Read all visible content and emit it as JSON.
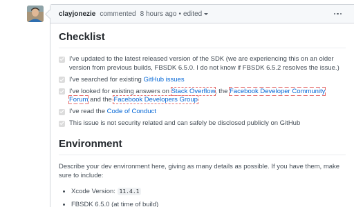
{
  "comment": {
    "author": "clayjonezie",
    "action": "commented",
    "time": "8 hours ago",
    "separator": "•",
    "edited_label": "edited",
    "more_label": "..."
  },
  "checklist": {
    "heading": "Checklist",
    "items": [
      {
        "text_before": "I've updated to the latest released version of the SDK (we are experiencing this on an older version from previous builds, FBSDK 6.5.0. I do not know if FBSDK 6.5.2 resolves the issue.)",
        "checked": true
      },
      {
        "text_before": "I've searched for existing ",
        "link": "GitHub issues",
        "checked": true
      },
      {
        "text_before": "I've looked for existing answers on ",
        "link1": "Stack Overflow",
        "text_mid1": ", the ",
        "link2": "Facebook Developer Community Forum",
        "text_mid2": " and the ",
        "link3": "Facebook Developers Group",
        "checked": true
      },
      {
        "text_before": "I've read the ",
        "link": "Code of Conduct",
        "checked": true
      },
      {
        "text_before": "This issue is not security related and can safely be disclosed publicly on GitHub",
        "checked": true
      }
    ]
  },
  "environment": {
    "heading": "Environment",
    "description": "Describe your dev environment here, giving as many details as possible. If you have them, make sure to include:",
    "bullets": [
      {
        "label": "Xcode Version: ",
        "code": "11.4.1"
      },
      {
        "label": "FBSDK 6.5.0 (at time of build)"
      }
    ]
  }
}
